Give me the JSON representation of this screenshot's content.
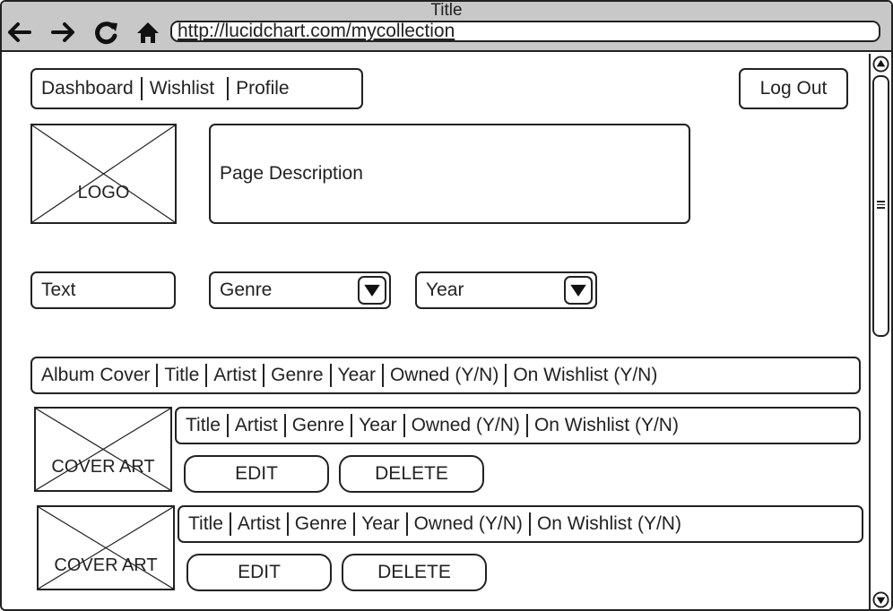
{
  "window": {
    "title": "Title",
    "url": "http://lucidchart.com/mycollection"
  },
  "browser_icons": [
    "back-arrow-icon",
    "forward-arrow-icon",
    "refresh-icon",
    "home-icon"
  ],
  "nav": {
    "items": [
      "Dashboard",
      "Wishlist",
      "Profile"
    ],
    "logout_label": "Log Out"
  },
  "logo_label": "LOGO",
  "page_description": "Page Description",
  "filters": {
    "text_label": "Text",
    "genre_label": "Genre",
    "year_label": "Year"
  },
  "table_header": [
    "Album Cover",
    "Title",
    "Artist",
    "Genre",
    "Year",
    "Owned (Y/N)",
    "On Wishlist (Y/N)"
  ],
  "albums": [
    {
      "cover_label": "COVER ART",
      "fields": [
        "Title",
        "Artist",
        "Genre",
        "Year",
        "Owned (Y/N)",
        "On Wishlist (Y/N)"
      ],
      "edit_label": "EDIT",
      "delete_label": "DELETE"
    },
    {
      "cover_label": "COVER ART",
      "fields": [
        "Title",
        "Artist",
        "Genre",
        "Year",
        "Owned (Y/N)",
        "On Wishlist (Y/N)"
      ],
      "edit_label": "EDIT",
      "delete_label": "DELETE"
    }
  ]
}
